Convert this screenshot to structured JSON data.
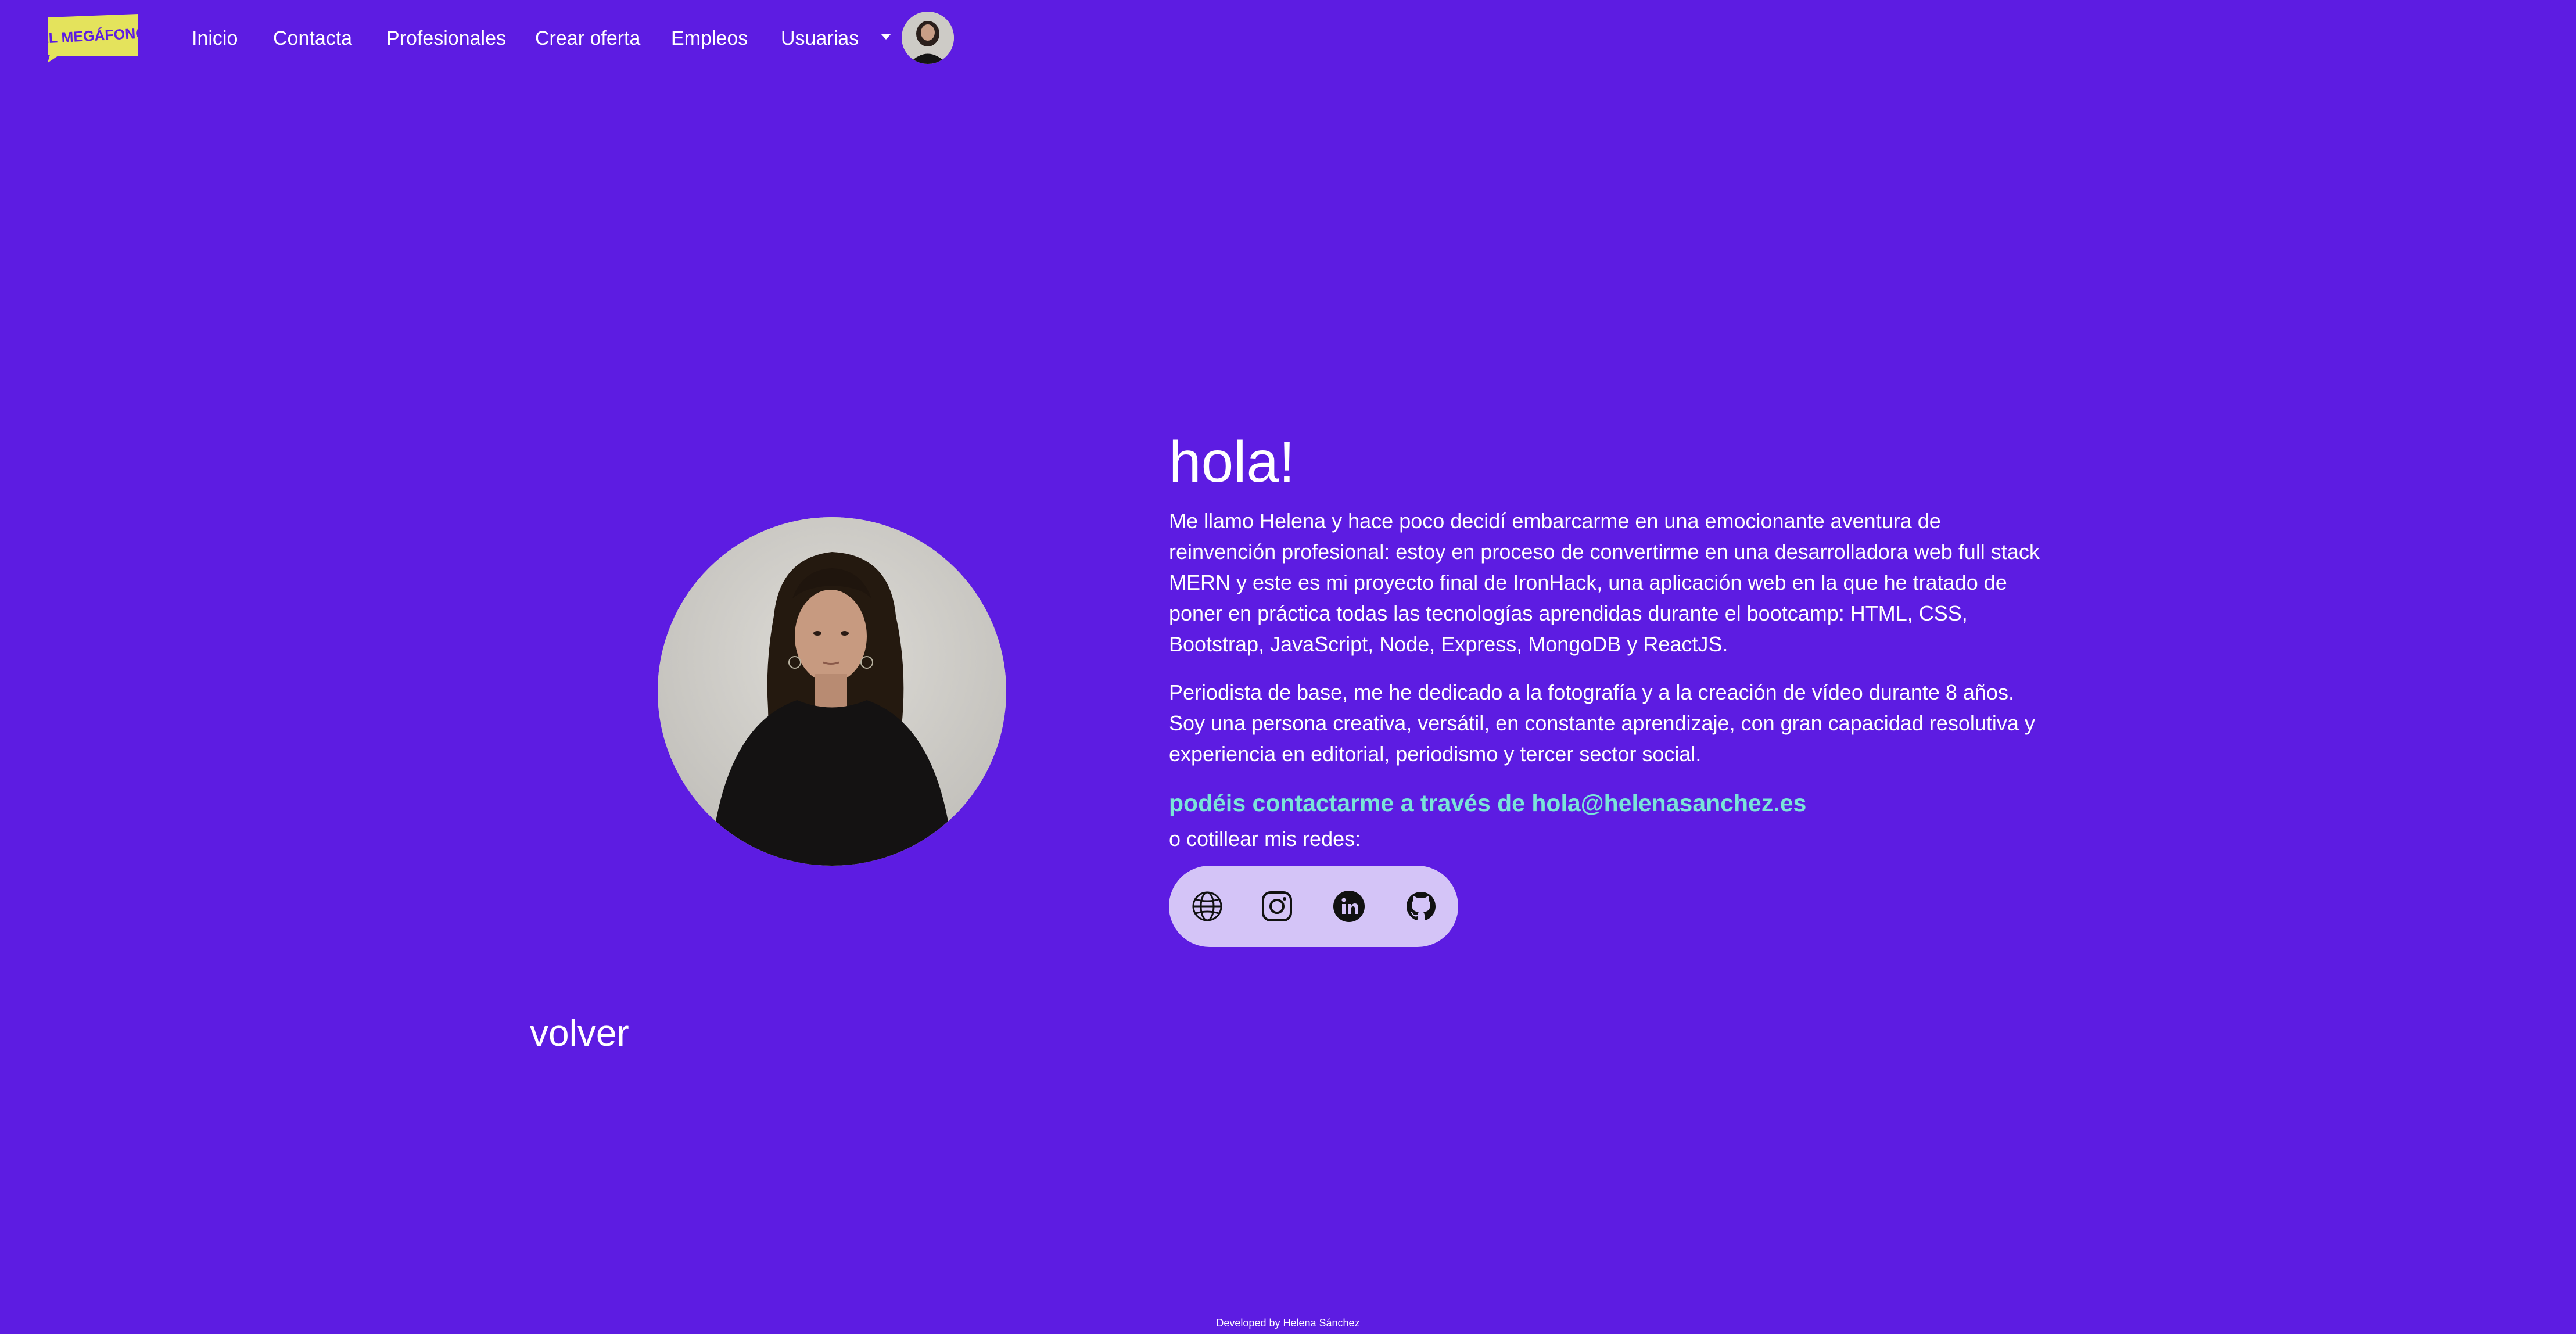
{
  "brand": {
    "logo_text": "EL MEGÁFONO",
    "logo_color": "#e4e35c"
  },
  "nav": {
    "items": [
      {
        "label": "Inicio"
      },
      {
        "label": "Contacta"
      },
      {
        "label": "Profesionales"
      },
      {
        "label": "Crear oferta"
      },
      {
        "label": "Empleos"
      },
      {
        "label": "Usuarias"
      }
    ],
    "dropdown_icon": "caret-down-icon",
    "avatar_icon": "user-avatar"
  },
  "profile": {
    "greeting": "hola!",
    "paragraphs": [
      "Me llamo Helena y hace poco decidí embarcarme en una emocionante aventura de reinvención profesional: estoy en proceso de convertirme en una desarrolladora web full stack MERN y este es mi proyecto final de IronHack, una aplicación web en la que he tratado de poner en práctica todas las tecnologías aprendidas durante el bootcamp: HTML, CSS, Bootstrap, JavaScript, Node, Express, MongoDB y ReactJS.",
      "Periodista de base, me he dedicado a la fotografía y a la creación de vídeo durante 8 años. Soy una persona creativa, versátil, en constante aprendizaje, con gran capacidad resolutiva y experiencia en editorial, periodismo y tercer sector social."
    ],
    "contact_line": "podéis contactarme a través de hola@helenasanchez.es",
    "social_label": "o cotillear mis redes:",
    "social_icons": [
      "globe-icon",
      "instagram-icon",
      "linkedin-icon",
      "github-icon"
    ]
  },
  "back_label": "volver",
  "footer_text": "Developed by Helena Sánchez",
  "colors": {
    "background": "#5d1ce2",
    "accent": "#7ae4d8",
    "social_bar": "#d4c4f7"
  }
}
